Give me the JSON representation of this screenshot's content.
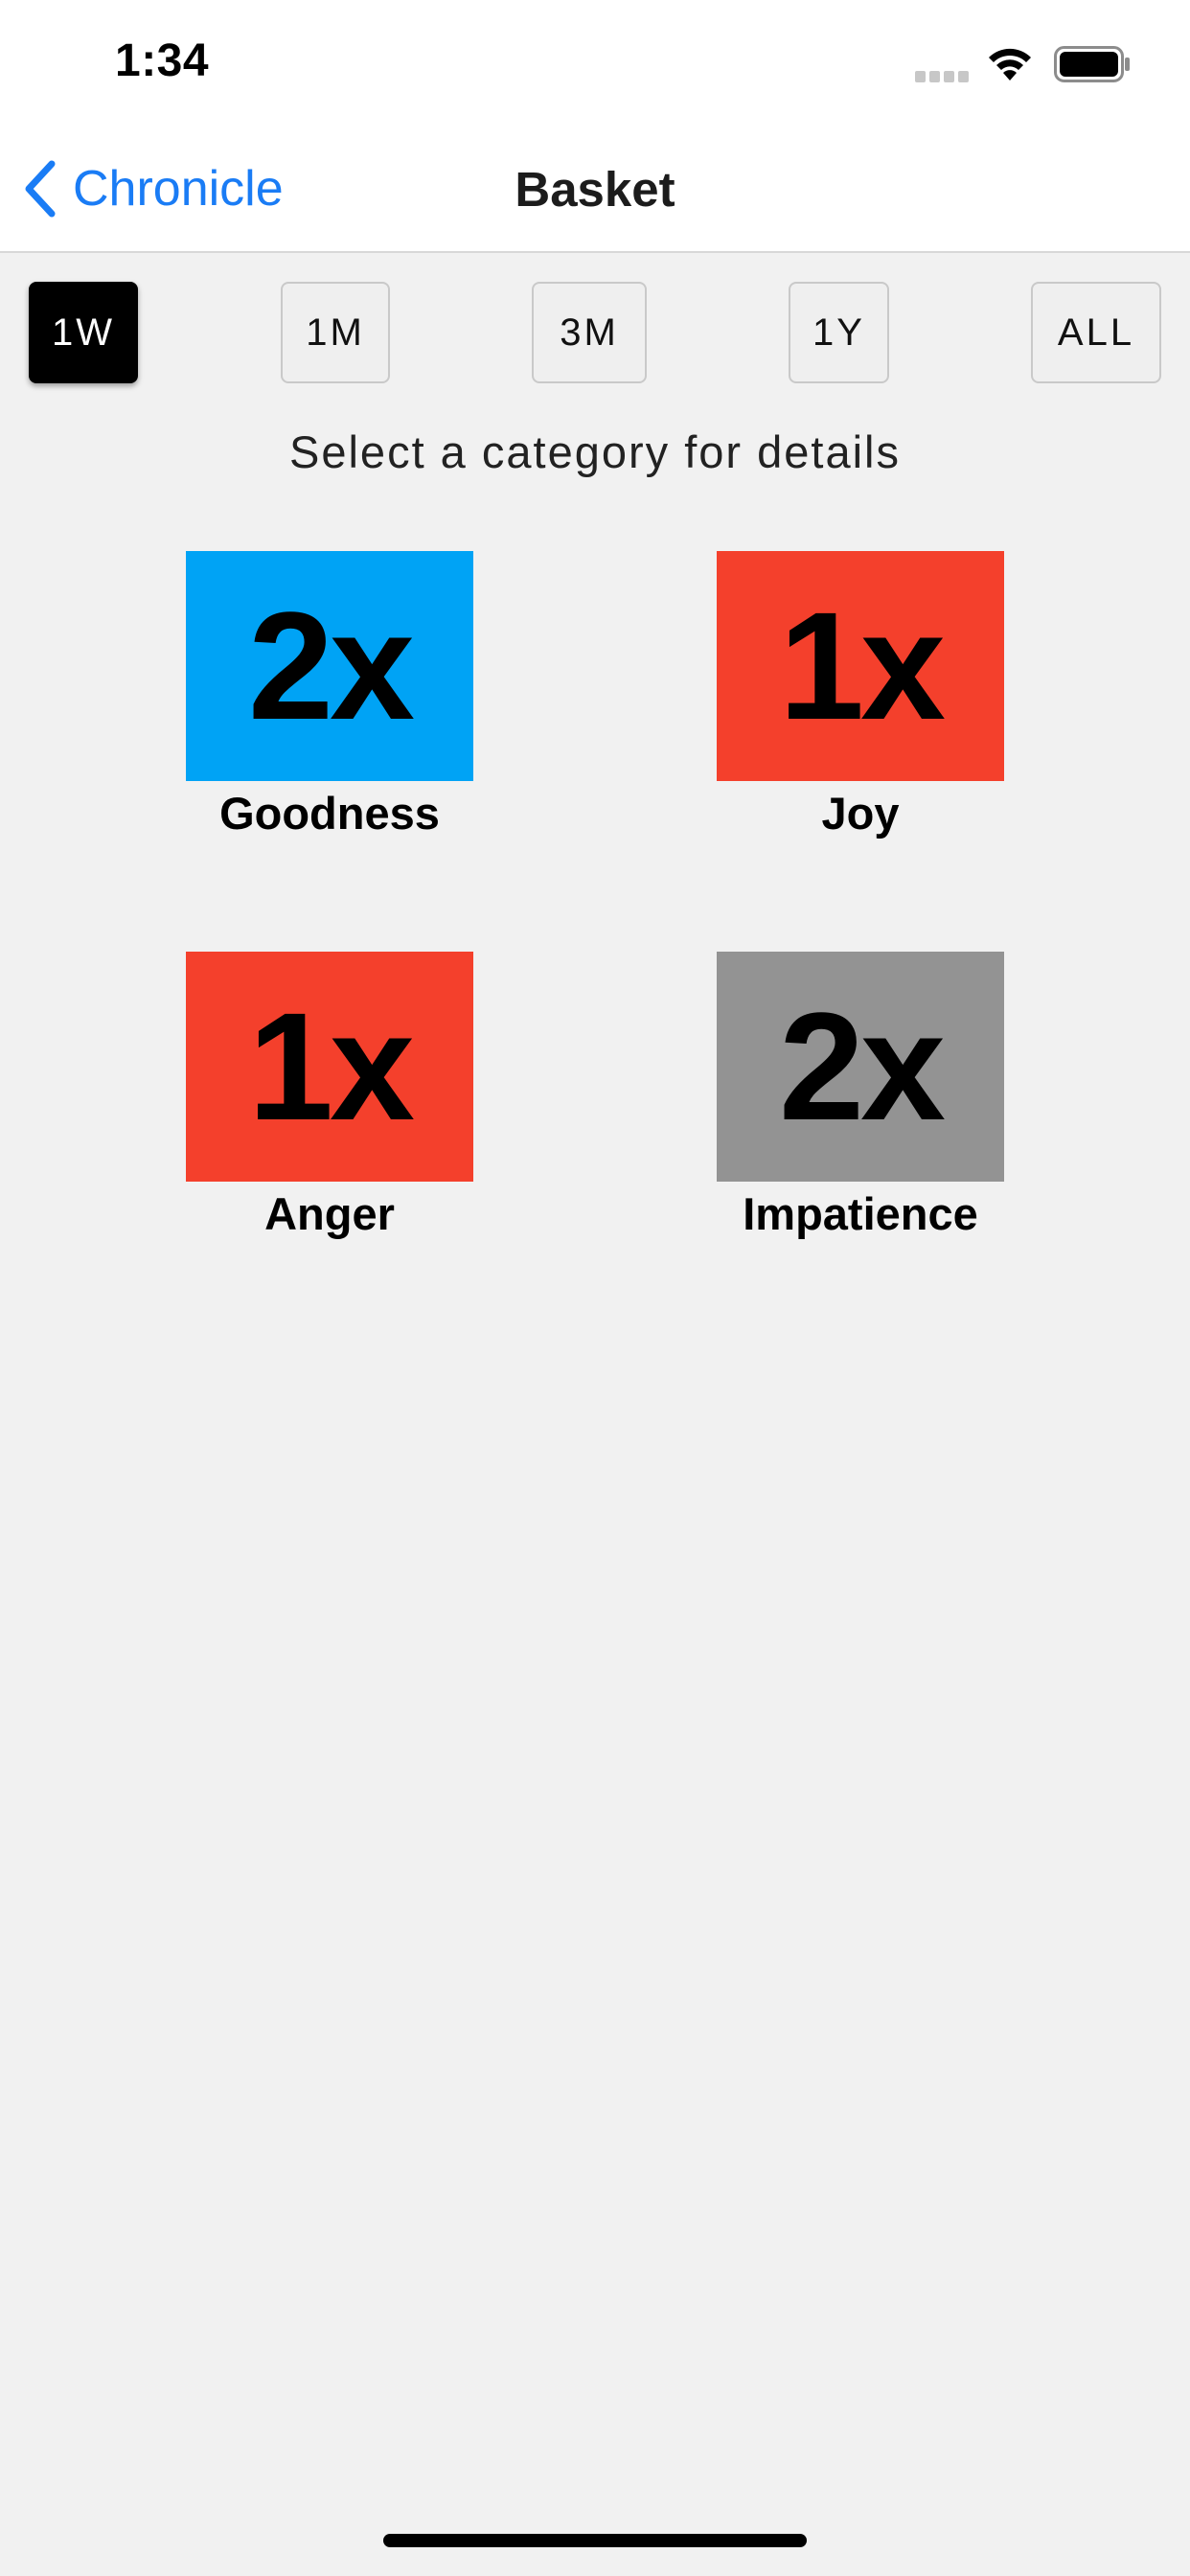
{
  "status_bar": {
    "time": "1:34"
  },
  "nav": {
    "back_label": "Chronicle",
    "title": "Basket"
  },
  "range": {
    "options": [
      "1W",
      "1M",
      "3M",
      "1Y",
      "ALL"
    ],
    "selected": "1W"
  },
  "hint": "Select a category for details",
  "categories": [
    {
      "count": "2x",
      "label": "Goodness",
      "color": "#00a3f5"
    },
    {
      "count": "1x",
      "label": "Joy",
      "color": "#f4402c"
    },
    {
      "count": "1x",
      "label": "Anger",
      "color": "#f4402c"
    },
    {
      "count": "2x",
      "label": "Impatience",
      "color": "#939393"
    }
  ],
  "colors": {
    "accent": "#1a7cf5",
    "background": "#f1f1f1"
  }
}
